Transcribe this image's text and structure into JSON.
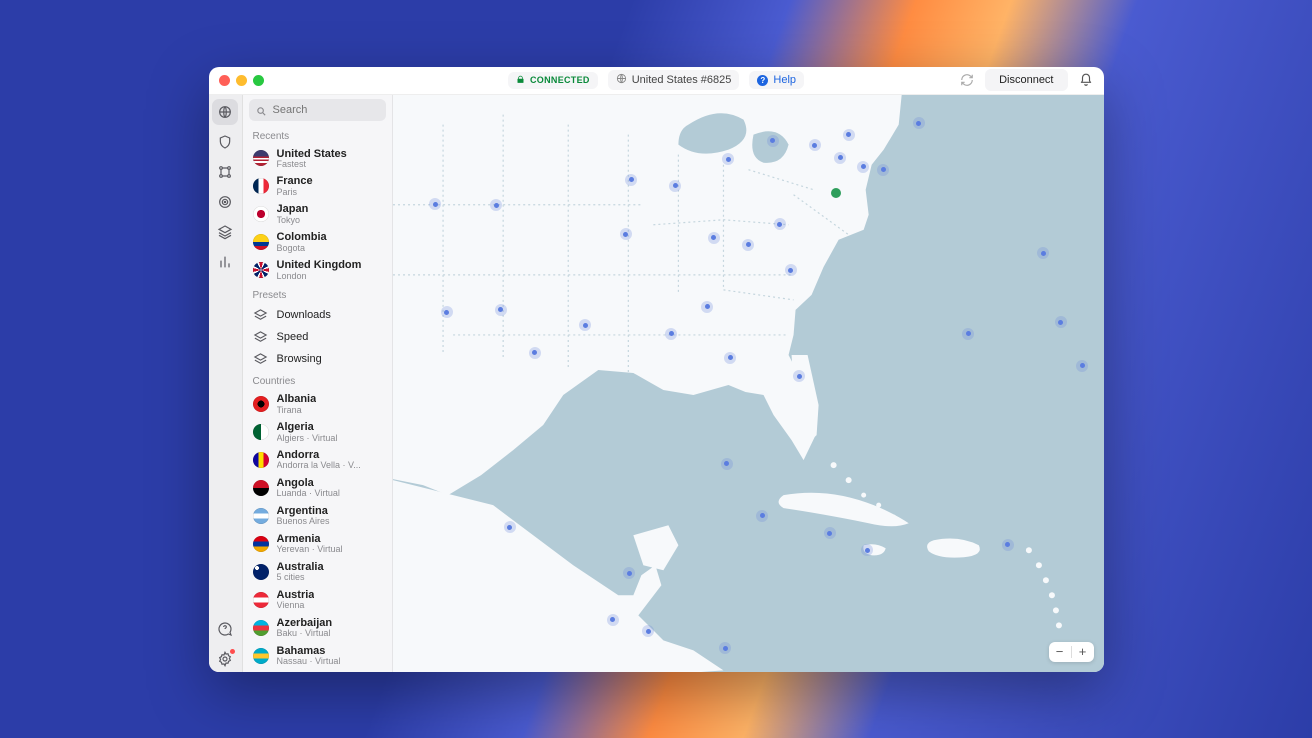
{
  "titlebar": {
    "status_label": "CONNECTED",
    "server_label": "United States #6825",
    "help_label": "Help",
    "disconnect_label": "Disconnect"
  },
  "search": {
    "placeholder": "Search"
  },
  "sections": {
    "recents": "Recents",
    "presets": "Presets",
    "countries": "Countries"
  },
  "recents": [
    {
      "name": "United States",
      "sub": "Fastest"
    },
    {
      "name": "France",
      "sub": "Paris"
    },
    {
      "name": "Japan",
      "sub": "Tokyo"
    },
    {
      "name": "Colombia",
      "sub": "Bogota"
    },
    {
      "name": "United Kingdom",
      "sub": "London"
    }
  ],
  "presets": [
    {
      "name": "Downloads"
    },
    {
      "name": "Speed"
    },
    {
      "name": "Browsing"
    }
  ],
  "countries": [
    {
      "name": "Albania",
      "sub": "Tirana"
    },
    {
      "name": "Algeria",
      "sub": "Algiers · Virtual"
    },
    {
      "name": "Andorra",
      "sub": "Andorra la Vella · V..."
    },
    {
      "name": "Angola",
      "sub": "Luanda · Virtual"
    },
    {
      "name": "Argentina",
      "sub": "Buenos Aires"
    },
    {
      "name": "Armenia",
      "sub": "Yerevan · Virtual"
    },
    {
      "name": "Australia",
      "sub": "5 cities"
    },
    {
      "name": "Austria",
      "sub": "Vienna"
    },
    {
      "name": "Azerbaijan",
      "sub": "Baku · Virtual"
    },
    {
      "name": "Bahamas",
      "sub": "Nassau · Virtual"
    }
  ],
  "flag_colors": {
    "United States": "linear-gradient(#3c3b6e 0 40%, #b22234 40% 50%, #fff 50% 60%, #b22234 60% 70%, #fff 70% 80%, #b22234 80% 100%)",
    "France": "linear-gradient(90deg,#002654 0 33%,#fff 33% 66%,#ed2939 66% 100%)",
    "Japan": "radial-gradient(circle at 50% 50%, #bc002d 0 35%, #fff 36% 100%)",
    "Colombia": "linear-gradient(#fdd116 0 50%,#003893 50% 75%,#ce1126 75% 100%)",
    "United Kingdom": "conic-gradient(#c8102e 0 4%, #fff 4% 8%, #012169 8% 17%, #fff 17% 21%, #c8102e 21% 29%, #fff 29% 33%, #012169 33% 42%, #fff 42% 46%, #c8102e 46% 54%, #fff 54% 58%, #012169 58% 67%, #fff 67% 71%, #c8102e 71% 79%, #fff 79% 83%, #012169 83% 92%, #fff 92% 96%, #c8102e 96% 100%)",
    "Albania": "radial-gradient(circle,#000 0 30%,#e41e20 31% 100%)",
    "Algeria": "linear-gradient(90deg,#006233 0 50%,#fff 50% 100%)",
    "Andorra": "linear-gradient(90deg,#10069f 0 33%,#fedd00 33% 66%,#d50032 66% 100%)",
    "Angola": "linear-gradient(#ce1126 0 50%,#000 50% 100%)",
    "Argentina": "linear-gradient(#74acdf 0 33%,#fff 33% 66%,#74acdf 66% 100%)",
    "Armenia": "linear-gradient(#d90012 0 33%,#0033a0 33% 66%,#f2a800 66% 100%)",
    "Australia": "radial-gradient(circle at 25% 25%, #fff 0 2px, transparent 2px), #012169",
    "Austria": "linear-gradient(#ed2939 0 33%,#fff 33% 66%,#ed2939 66% 100%)",
    "Azerbaijan": "linear-gradient(#00b5e2 0 33%,#ef3340 33% 66%,#509e2f 66% 100%)",
    "Bahamas": "linear-gradient(#00abc9 0 33%,#ffc72c 33% 66%,#00abc9 66% 100%)"
  },
  "map_markers": [
    {
      "x": 62.5,
      "y": 17.2,
      "connected": true
    },
    {
      "x": 64.2,
      "y": 7.0
    },
    {
      "x": 59.4,
      "y": 8.8
    },
    {
      "x": 53.5,
      "y": 8.0
    },
    {
      "x": 47.2,
      "y": 11.2
    },
    {
      "x": 39.8,
      "y": 15.8
    },
    {
      "x": 33.6,
      "y": 14.8
    },
    {
      "x": 32.8,
      "y": 24.2
    },
    {
      "x": 44.3,
      "y": 36.8
    },
    {
      "x": 39.2,
      "y": 41.5
    },
    {
      "x": 27.1,
      "y": 40.0
    },
    {
      "x": 20.0,
      "y": 44.8
    },
    {
      "x": 15.2,
      "y": 37.3
    },
    {
      "x": 7.6,
      "y": 37.7
    },
    {
      "x": 6.0,
      "y": 19.0
    },
    {
      "x": 14.6,
      "y": 19.2
    },
    {
      "x": 45.2,
      "y": 24.8
    },
    {
      "x": 50.0,
      "y": 26.0
    },
    {
      "x": 54.5,
      "y": 22.5
    },
    {
      "x": 56.0,
      "y": 30.5
    },
    {
      "x": 47.5,
      "y": 45.6
    },
    {
      "x": 57.2,
      "y": 48.8
    },
    {
      "x": 63.0,
      "y": 11.0
    },
    {
      "x": 66.2,
      "y": 12.5
    },
    {
      "x": 69.0,
      "y": 13.0
    },
    {
      "x": 74.0,
      "y": 5.0
    },
    {
      "x": 91.5,
      "y": 27.5
    },
    {
      "x": 94.0,
      "y": 39.5
    },
    {
      "x": 81.0,
      "y": 41.5
    },
    {
      "x": 97.0,
      "y": 47.0
    },
    {
      "x": 16.5,
      "y": 75.0
    },
    {
      "x": 33.3,
      "y": 83.0
    },
    {
      "x": 31.0,
      "y": 91.0
    },
    {
      "x": 36.0,
      "y": 93.0
    },
    {
      "x": 46.8,
      "y": 96.0
    },
    {
      "x": 52.0,
      "y": 73.0
    },
    {
      "x": 61.5,
      "y": 76.0
    },
    {
      "x": 66.8,
      "y": 79.0
    },
    {
      "x": 86.5,
      "y": 78.0
    },
    {
      "x": 47.0,
      "y": 64.0
    }
  ]
}
